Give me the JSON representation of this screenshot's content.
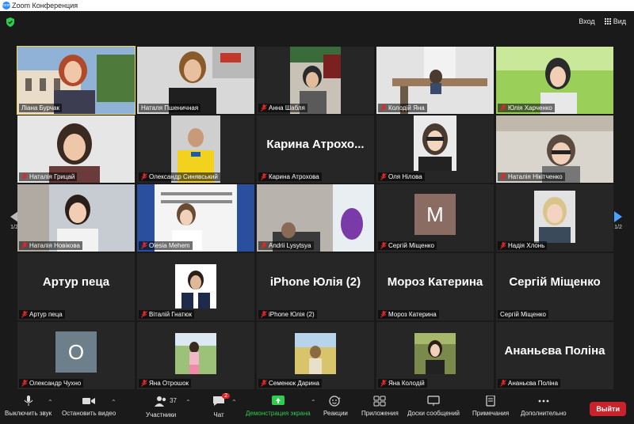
{
  "window_title": "Zoom Конференция",
  "logo_text": "zoom",
  "top_right": {
    "login": "Вход",
    "view": "Вид"
  },
  "page_left": "1/2",
  "page_right": "1/2",
  "colors": {
    "active_border": "#f0d84a",
    "share_green": "#2ecc4f",
    "leave_red": "#c8232b",
    "muted_red": "#e02828"
  },
  "tiles": [
    {
      "name": "Ліана Бурчак",
      "muted": false,
      "kind": "video"
    },
    {
      "name": "Наталя Пшеничная",
      "muted": false,
      "kind": "video"
    },
    {
      "name": "Анна Шабля",
      "muted": true,
      "kind": "video"
    },
    {
      "name": "Колодій Яна",
      "muted": true,
      "kind": "video"
    },
    {
      "name": "Юлія Харченко",
      "muted": true,
      "kind": "video"
    },
    {
      "name": "Наталія Грицай",
      "muted": true,
      "kind": "video"
    },
    {
      "name": "Олександр Синявський",
      "muted": true,
      "kind": "video"
    },
    {
      "name": "Карина Атрохова",
      "muted": true,
      "kind": "text",
      "big": "Карина Атрохо..."
    },
    {
      "name": "Оля Нілова",
      "muted": true,
      "kind": "video"
    },
    {
      "name": "Наталія Нікітченко",
      "muted": true,
      "kind": "video"
    },
    {
      "name": "Наталія Новікова",
      "muted": true,
      "kind": "video"
    },
    {
      "name": "Olesia Mehem",
      "muted": true,
      "kind": "video"
    },
    {
      "name": "Andrii Lysytsya",
      "muted": true,
      "kind": "video"
    },
    {
      "name": "Сергій Міщенко",
      "muted": true,
      "kind": "avatar",
      "initial": "М"
    },
    {
      "name": "Надія Хлонь",
      "muted": true,
      "kind": "video"
    },
    {
      "name": "Артур пеца",
      "muted": true,
      "kind": "text",
      "big": "Артур пеца"
    },
    {
      "name": "Віталій Гнатюк",
      "muted": true,
      "kind": "video"
    },
    {
      "name": "iPhone Юлія (2)",
      "muted": true,
      "kind": "text",
      "big": "iPhone Юлія (2)"
    },
    {
      "name": "Мороз Катерина",
      "muted": true,
      "kind": "text",
      "big": "Мороз Катерина"
    },
    {
      "name": "Сергій Міщенко",
      "muted": false,
      "kind": "text",
      "big": "Сергій Міщенко"
    },
    {
      "name": "Олександр Чухно",
      "muted": true,
      "kind": "avatar",
      "initial": "О"
    },
    {
      "name": "Яна Отрошок",
      "muted": true,
      "kind": "video"
    },
    {
      "name": "Семенюк Дарина",
      "muted": true,
      "kind": "video"
    },
    {
      "name": "Яна Колодій",
      "muted": true,
      "kind": "video"
    },
    {
      "name": "Ананьєва Поліна",
      "muted": true,
      "kind": "text",
      "big": "Ананьєва Поліна"
    }
  ],
  "toolbar": {
    "mute": "Выключить звук",
    "video": "Остановить видео",
    "participants": "Участники",
    "participants_count": "37",
    "chat": "Чат",
    "chat_badge": "2",
    "share": "Демонстрация экрана",
    "reactions": "Реакции",
    "apps": "Приложения",
    "whiteboards": "Доски сообщений",
    "notes": "Примечания",
    "more": "Дополнительно",
    "leave": "Выйти"
  }
}
